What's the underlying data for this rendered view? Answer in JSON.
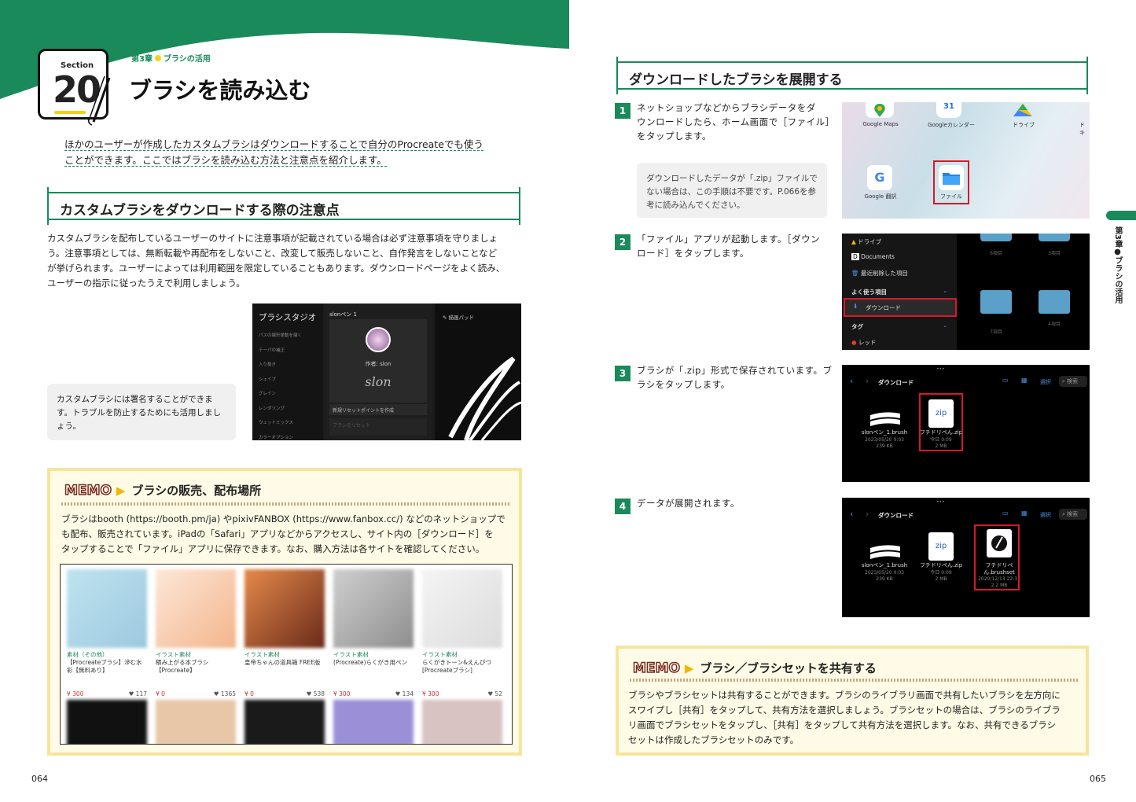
{
  "left_page": {
    "section_label": "Section",
    "section_number": "20",
    "chapter_tag": "第3章",
    "chapter_topic": "ブラシの活用",
    "title": "ブラシを読み込む",
    "intro_line1": "ほかのユーザーが作成したカスタムブラシはダウンロードすることで自分のProcreateでも使う",
    "intro_line2": "ことができます。ここではブラシを読み込む方法と注意点を紹介します。",
    "heading": "カスタムブラシをダウンロードする際の注意点",
    "body": [
      "カスタムブラシを配布しているユーザーのサイトに注意事項が記載されている場合は必ず注意事項を守りましょ",
      "う。注意事項としては、無断転載や再配布をしないこと、改変して販売しないこと、自作発言をしないことなど",
      "が挙げられます。ユーザーによっては利用範囲を限定していることもあります。ダウンロードページをよく読み、",
      "ユーザーの指示に従ったうえで利用しましょう。"
    ],
    "note": "カスタムブラシには署名することができます。トラブルを防止するためにも活用しましょう。",
    "studio": {
      "title": "ブラシスタジオ",
      "menu": [
        "パスの線形挙動を描く",
        "テーパの補正",
        "入り抜き",
        "シェイプ",
        "グレイン",
        "レンダリング",
        "ウェットミックス",
        "カラーオプション"
      ],
      "brush_name": "slonペン 1",
      "author": "作者: slon",
      "signature": "slon",
      "new_reset": "新規リセットポイントを作成",
      "reset": "ブラシをリセット",
      "drawing_pad": "描画パッド"
    },
    "memo": {
      "logo": "MEMO",
      "title": "ブラシの販売、配布場所",
      "body": [
        "ブラシはbooth (https://booth.pm/ja) やpixivFANBOX (https://www.fanbox.cc/) などのネットショップで",
        "も配布、販売されています。iPadの「Safari」アプリなどからアクセスし、サイト内の［ダウンロード］を",
        "タップすることで「ファイル」アプリに保存できます。なお、購入方法は各サイトを確認してください。"
      ],
      "cards": [
        {
          "cat": "素材（その他）",
          "title": "【Procreateブラシ】滲む水彩【無料あり】",
          "price": "¥ 300",
          "likes": "117"
        },
        {
          "cat": "イラスト素材",
          "title": "積み上がる本ブラシ【Procreate】",
          "price": "¥ 0",
          "likes": "1365"
        },
        {
          "cat": "イラスト素材",
          "title": "皇帝ちゃんの道具箱 FREE版",
          "price": "¥ 0",
          "likes": "538"
        },
        {
          "cat": "イラスト素材",
          "title": "(Procreate)らくがき用ペン",
          "price": "¥ 300",
          "likes": "134"
        },
        {
          "cat": "イラスト素材",
          "title": "らくがきトーン&えんぴつ[Procreateブラシ]",
          "price": "¥ 300",
          "likes": "52"
        }
      ]
    },
    "page_number": "064"
  },
  "right_page": {
    "heading": "ダウンロードしたブラシを展開する",
    "steps": [
      {
        "num": "1",
        "lines": [
          "ネットショップなどからブラシデータをダ",
          "ウンロードしたら、ホーム画面で［ファイル］",
          "をタップします。"
        ]
      },
      {
        "num": "2",
        "lines": [
          "「ファイル」アプリが起動します。［ダウン",
          "ロード］をタップします。"
        ]
      },
      {
        "num": "3",
        "lines": [
          "ブラシが「.zip」形式で保存されています。ブ",
          "ラシをタップします。"
        ]
      },
      {
        "num": "4",
        "lines": [
          "データが展開されます。"
        ]
      }
    ],
    "step1_note": "ダウンロードしたデータが「.zip」ファイルでない場合は、この手順は不要です。P.066を参考に読み込んでください。",
    "home_apps": [
      "Google Maps",
      "Googleカレンダー",
      "ドライブ",
      "ドキ",
      "Google 翻訳",
      "ファイル"
    ],
    "calendar_day": "31",
    "files_sidebar": [
      "ドライブ",
      "Documents",
      "最近削除した項目",
      "よく使う項目",
      "ダウンロード",
      "タグ",
      "レッド"
    ],
    "files_folder_counts": [
      "6項目",
      "3項目",
      "7項目",
      "4項目"
    ],
    "downloads_title": "ダウンロード",
    "toolbar": {
      "select": "選択",
      "search": "検索"
    },
    "files3": [
      {
        "name": "slonペン_1.brush",
        "date": "2023/05/20 0:03",
        "size": "239 KB"
      },
      {
        "name": "フチドリペん.zip",
        "date": "今日 0:09",
        "size": "2 MB"
      }
    ],
    "files4": [
      {
        "name": "slonペン_1.brush",
        "date": "2023/05/20 0:03",
        "size": "239 KB"
      },
      {
        "name": "フチドリペん.zip",
        "date": "今日 0:09",
        "size": "2 MB"
      },
      {
        "name": "フチドリペん.brushset",
        "date": "2020/12/13 22:31",
        "size": "2.2 MB"
      }
    ],
    "zip_label": "zip",
    "memo": {
      "logo": "MEMO",
      "title": "ブラシ／ブラシセットを共有する",
      "body": [
        "ブラシやブラシセットは共有することができます。ブラシのライブラリ画面で共有したいブラシを左方向に",
        "スワイプし［共有］をタップして、共有方法を選択しましょう。ブラシセットの場合は、ブラシのライブラ",
        "リ画面でブラシセットをタップし、［共有］をタップして共有方法を選択します。なお、共有できるブラシ",
        "セットは作成したブラシセットのみです。"
      ]
    },
    "side_tab": "第3章●ブラシの活用",
    "page_number": "065"
  },
  "colors": {
    "accent": "#1a8a5a",
    "memo_border": "#f6e49b",
    "highlight_red": "#d41a2a"
  }
}
